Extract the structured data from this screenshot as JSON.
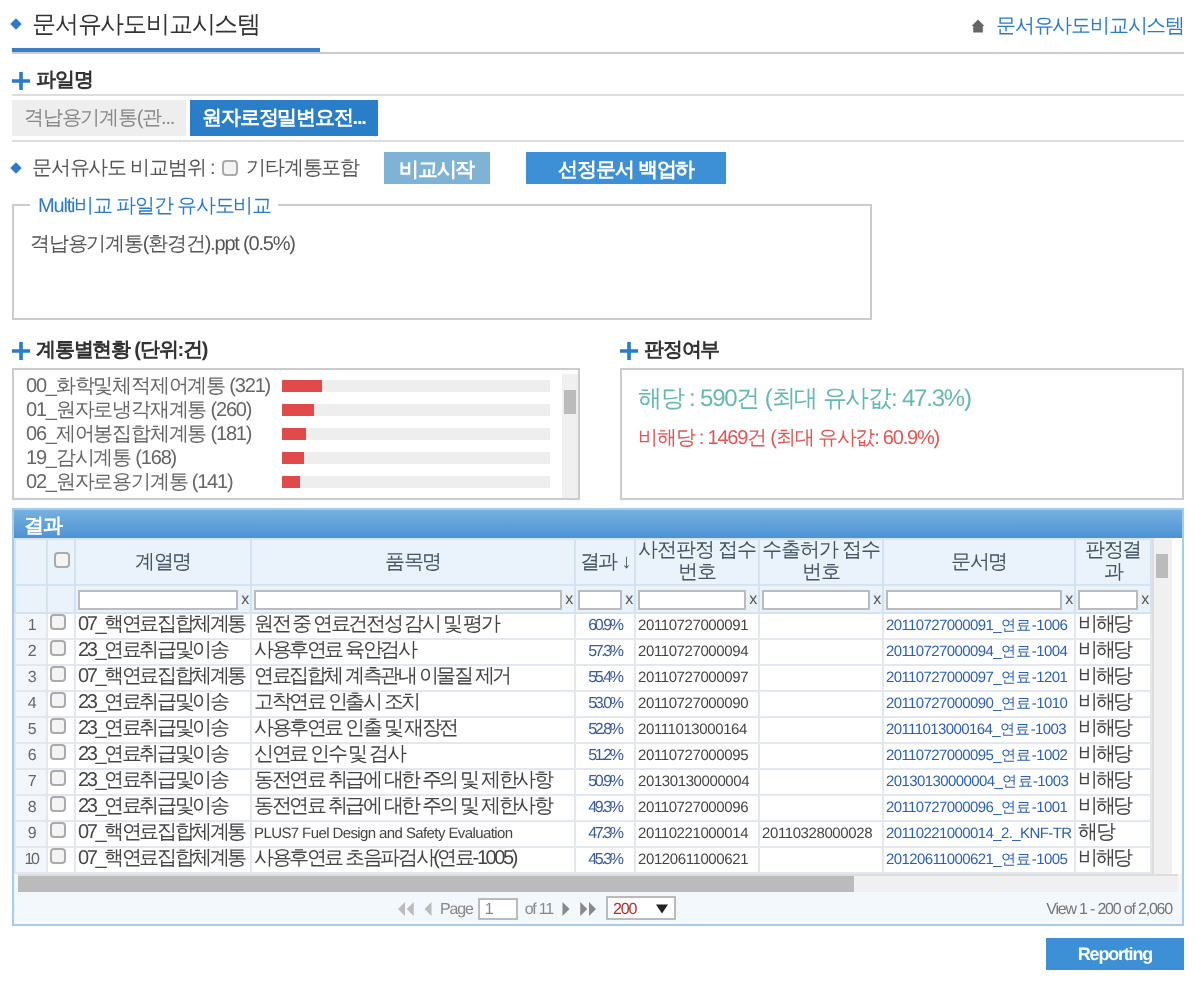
{
  "header": {
    "title": "문서유사도비교시스템",
    "breadcrumb": "문서유사도비교시스템"
  },
  "file_section": {
    "title": "파일명",
    "tabs": [
      {
        "label": "격납용기계통(관...",
        "selected": false
      },
      {
        "label": "원자로정밀변요전...",
        "selected": true
      }
    ]
  },
  "compare": {
    "label": "문서유사도 비교범위 :",
    "option": {
      "label": "기타계통포함",
      "checked": false
    },
    "buttons": [
      {
        "label": "비교시작",
        "kind": "secondary"
      },
      {
        "label": "선정문서 백업하",
        "kind": "primary"
      }
    ]
  },
  "multi": {
    "legend": "Multi비교 파일간 유사도비교",
    "items": [
      "격납용기계통(환경건).ppt (0.5%)"
    ]
  },
  "systems": {
    "title": "계통별현황 (단위:건)",
    "items": [
      {
        "label": "00_화학및체적제어계통 (321)",
        "level": 0.15
      },
      {
        "label": "01_원자로냉각재계통 (260)",
        "level": 0.12
      },
      {
        "label": "06_제어봉집합체계통 (181)",
        "level": 0.09
      },
      {
        "label": "19_감시계통 (168)",
        "level": 0.08
      },
      {
        "label": "02_원자로용기계통 (141)",
        "level": 0.065
      }
    ]
  },
  "judgement": {
    "title": "판정여부",
    "lines": [
      {
        "kind": "match",
        "text": "해당 : 590건 (최대 유사값: 47.3%)"
      },
      {
        "kind": "nonmatch",
        "text": "비해당 : 1469건 (최대 유사값: 60.9%)"
      }
    ]
  },
  "grid": {
    "caption": "결과",
    "header_checked": false,
    "columns": [
      {
        "label": "계열명",
        "clear": "x"
      },
      {
        "label": "품목명",
        "clear": "x"
      },
      {
        "label": "결과 ↓",
        "clear": "x"
      },
      {
        "label": "사전판정 접수번호",
        "clear": "x"
      },
      {
        "label": "수출허가 접수번호",
        "clear": "x"
      },
      {
        "label": "문서명",
        "clear": "x"
      },
      {
        "label": "판정결과",
        "clear": "x"
      }
    ],
    "rows": [
      {
        "num": "1",
        "checked": false,
        "system": "07_핵연료집합체계통",
        "item": "원전 중 연료건전성 감시 및 평가",
        "result": "60.9%",
        "pre_no": "20110727000091",
        "doc": "20110727000091_연료-1006",
        "judge": "비해당"
      },
      {
        "num": "2",
        "checked": false,
        "system": "23_연료취급및이송",
        "item": "사용후연료 육안검사",
        "result": "57.3%",
        "pre_no": "20110727000094",
        "doc": "20110727000094_연료-1004",
        "judge": "비해당"
      },
      {
        "num": "3",
        "checked": false,
        "system": "07_핵연료집합체계통",
        "item": "연료집합체 계측관내 이물질 제거",
        "result": "55.4%",
        "pre_no": "20110727000097",
        "doc": "20110727000097_연료-1201",
        "judge": "비해당"
      },
      {
        "num": "4",
        "checked": false,
        "system": "23_연료취급및이송",
        "item": "고착연료 인출시 조치",
        "result": "53.0%",
        "pre_no": "20110727000090",
        "doc": "20110727000090_연료-1010",
        "judge": "비해당"
      },
      {
        "num": "5",
        "checked": false,
        "system": "23_연료취급및이송",
        "item": "사용후연료 인출 및 재장전",
        "result": "52.8%",
        "pre_no": "20111013000164",
        "doc": "20111013000164_연료-1003",
        "judge": "비해당"
      },
      {
        "num": "6",
        "checked": false,
        "system": "23_연료취급및이송",
        "item": "신연료 인수 및 검사",
        "result": "51.2%",
        "pre_no": "20110727000095",
        "doc": "20110727000095_연료-1002",
        "judge": "비해당"
      },
      {
        "num": "7",
        "checked": false,
        "system": "23_연료취급및이송",
        "item": "동전연료 취급에 대한 주의 및 제한사항",
        "result": "50.9%",
        "pre_no": "20130130000004",
        "doc": "20130130000004_연료-1003",
        "judge": "비해당"
      },
      {
        "num": "8",
        "checked": false,
        "system": "23_연료취급및이송",
        "item": "동전연료 취급에 대한 주의 및 제한사항",
        "result": "49.3%",
        "pre_no": "20110727000096",
        "doc": "20110727000096_연료-1001",
        "judge": "비해당"
      },
      {
        "num": "9",
        "checked": false,
        "system": "07_핵연료집합체계통",
        "item": "PLUS7 Fuel Design and Safety Evaluation",
        "result": "47.3%",
        "pre_no": "20110221000014",
        "export_no": "20110328000028",
        "doc": "20110221000014_2._KNF-TR",
        "judge": "해당"
      },
      {
        "num": "10",
        "checked": false,
        "system": "07_핵연료집합체계통",
        "item": "사용후연료 초음파검사(연료-1005)",
        "result": "45.3%",
        "pre_no": "20120611000621",
        "doc": "20120611000621_연료-1005",
        "judge": "비해당"
      }
    ]
  },
  "pager": {
    "page_label": "Page",
    "page": "1",
    "of": "of 11",
    "page_size": "200",
    "view": "View 1 - 200 of 2,060"
  },
  "reporting": "Reporting"
}
